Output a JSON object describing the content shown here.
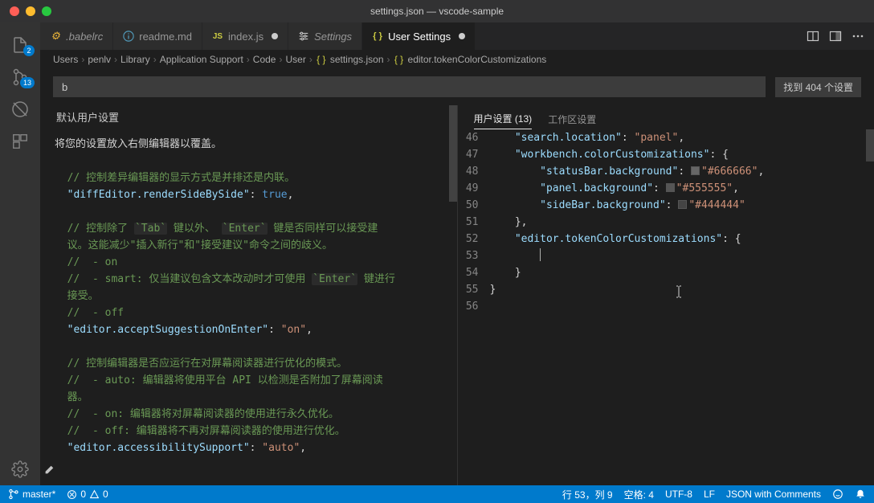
{
  "window": {
    "title": "settings.json — vscode-sample"
  },
  "activity": {
    "files_badge": "2",
    "scm_badge": "13"
  },
  "tabs": [
    {
      "label": ".babelrc",
      "italic": true,
      "iconColor": "#e8b339"
    },
    {
      "label": "readme.md",
      "iconColor": "#519aba"
    },
    {
      "label": "index.js",
      "dirty": true,
      "iconColor": "#cbcb41"
    },
    {
      "label": "Settings",
      "italic": true,
      "isSettings": true
    },
    {
      "label": "User Settings",
      "active": true,
      "dirty": true,
      "isSettings": true
    }
  ],
  "breadcrumbs": {
    "parts": [
      "Users",
      "penlv",
      "Library",
      "Application Support",
      "Code",
      "User"
    ],
    "file": "settings.json",
    "symbol": "editor.tokenColorCustomizations"
  },
  "search": {
    "value": "b",
    "resultText": "找到 404 个设置"
  },
  "left": {
    "header": "默认用户设置",
    "hint": "将您的设置放入右侧编辑器以覆盖。",
    "c1": "控制差异编辑器的显示方式是并排还是内联。",
    "k1": "diffEditor.renderSideBySide",
    "v1": "true",
    "c2a": "控制除了 `Tab` 键以外、 `Enter` 键是否同样可以接受建",
    "c2b": "议。这能减少\"插入新行\"和\"接受建议\"命令之间的歧义。",
    "c2c": " - on",
    "c2d": " - smart: 仅当建议包含文本改动时才可使用 `Enter` 键进行",
    "c2e": "接受。",
    "c2f": " - off",
    "k2": "editor.acceptSuggestionOnEnter",
    "v2": "on",
    "c3a": "控制编辑器是否应运行在对屏幕阅读器进行优化的模式。",
    "c3b": " - auto: 编辑器将使用平台 API 以检测是否附加了屏幕阅读",
    "c3c": "器。",
    "c3d": " - on: 编辑器将对屏幕阅读器的使用进行永久优化。",
    "c3e": " - off: 编辑器将不再对屏幕阅读器的使用进行优化。",
    "k3": "editor.accessibilitySupport",
    "v3": "auto"
  },
  "right": {
    "tab1": "用户设置 (13)",
    "tab2": "工作区设置",
    "lines": [
      "46",
      "47",
      "48",
      "49",
      "50",
      "51",
      "52",
      "53",
      "54",
      "55",
      "56"
    ],
    "k_search": "search.location",
    "v_search": "panel",
    "k_workbench": "workbench.colorCustomizations",
    "k_status": "statusBar.background",
    "v_status": "#666666",
    "k_panel": "panel.background",
    "v_panel": "#555555",
    "k_sidebar": "sideBar.background",
    "v_sidebar": "#444444",
    "k_token": "editor.tokenColorCustomizations"
  },
  "status": {
    "branch": "master*",
    "errors": "0",
    "warnings": "0",
    "pos": "行 53，列 9",
    "spaces": "空格: 4",
    "encoding": "UTF-8",
    "eol": "LF",
    "lang": "JSON with Comments"
  }
}
